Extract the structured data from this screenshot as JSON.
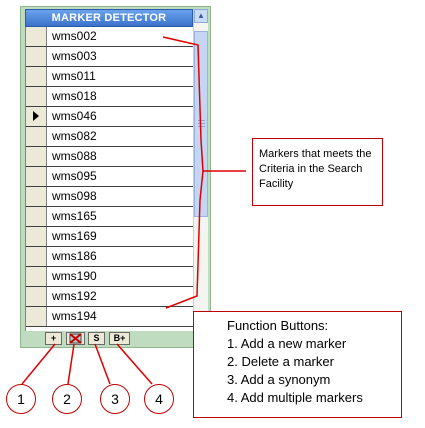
{
  "header": {
    "title": "MARKER DETECTOR"
  },
  "markers": [
    "wms002",
    "wms003",
    "wms011",
    "wms018",
    "wms046",
    "wms082",
    "wms088",
    "wms095",
    "wms098",
    "wms165",
    "wms169",
    "wms186",
    "wms190",
    "wms192",
    "wms194"
  ],
  "current_row_index": 4,
  "scrollbar": {
    "up_icon": "chevron-up-icon",
    "down_icon": "chevron-down-icon"
  },
  "function_buttons": [
    {
      "label": "+",
      "icon": "add-icon"
    },
    {
      "label": "",
      "icon": "delete-icon"
    },
    {
      "label": "S",
      "icon": "synonym-icon"
    },
    {
      "label": "B+",
      "icon": "bulk-add-icon"
    }
  ],
  "callout_markers": {
    "text": "Markers that meets the Criteria in the Search Facility"
  },
  "callout_functions": {
    "title": "Function Buttons:",
    "items": [
      "1.  Add a new marker",
      "2.  Delete a marker",
      "3.  Add a synonym",
      "4.  Add multiple markers"
    ]
  },
  "button_numbers": [
    "1",
    "2",
    "3",
    "4"
  ],
  "colors": {
    "header_bg": "#3a72cc",
    "panel_bg": "#c0dcc0",
    "annotation_red": "#e00000"
  }
}
